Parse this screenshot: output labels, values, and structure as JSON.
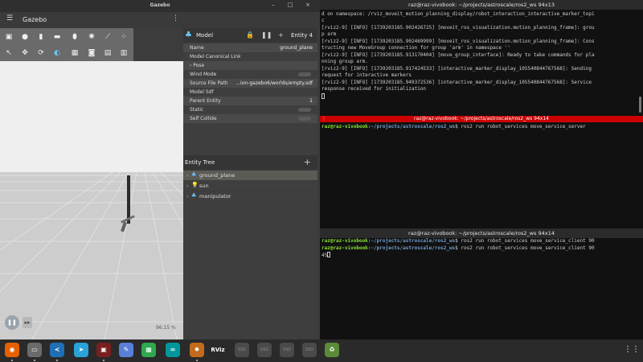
{
  "gazebo": {
    "window_title": "Gazebo",
    "app_name": "Gazebo",
    "window_controls": [
      "–",
      "□",
      "×"
    ],
    "menu_glyph": "☰",
    "more_glyph": "⋮",
    "toolbar_top": [
      "▣",
      "●",
      "▮",
      "▬",
      "⬮",
      "✺",
      "⟋",
      "⁘"
    ],
    "toolbar_bottom": [
      "↖",
      "✥",
      "⟳",
      "◐",
      "▦",
      "◙",
      "▤",
      "▥"
    ],
    "viewport": {
      "play_glyph": "❚❚",
      "step_glyph": "▸▸",
      "rtf": "96.15 %"
    },
    "inspector": {
      "icon": "♣",
      "title": "Model",
      "lock_glyph": "🔒",
      "pause_glyph": "❚❚",
      "plus_glyph": "+",
      "entity": "Entity 4",
      "rows": [
        {
          "key": "Name",
          "value": "ground_plane"
        },
        {
          "key": "Model Canonical Link",
          "value": ""
        },
        {
          "key": "› Pose",
          "value": ""
        },
        {
          "key": "Wind Mode",
          "value": ""
        },
        {
          "key": "Source File Path",
          "value": "...ion-gazebo6/worlds/empty.sdf"
        },
        {
          "key": "Model Sdf",
          "value": ""
        },
        {
          "key": "Parent Entity",
          "value": "1"
        },
        {
          "key": "Static",
          "value": ""
        },
        {
          "key": "Self Collide",
          "value": ""
        }
      ]
    },
    "entity_tree": {
      "title": "Entity Tree",
      "plus_glyph": "+",
      "items": [
        {
          "arrow": "›",
          "icon": "♣",
          "name": "ground_plane"
        },
        {
          "arrow": "›",
          "icon": "💡",
          "name": "sun"
        },
        {
          "arrow": "›",
          "icon": "♣",
          "name": "manipulator"
        }
      ]
    }
  },
  "terminal1": {
    "title": "raz@raz-vivobook: ~/projects/astroscale/ros2_ws 94x13",
    "lines": [
      "d on namespace: /rviz_moveit_motion_planning_display/robot_interaction_interactive_marker_topi",
      "c",
      "[rviz2-9] [INFO] [1739203185.902426725] [moveit_ros_visualization.motion_planning_frame]: grou",
      "p arm",
      "[rviz2-9] [INFO] [1739203185.902469999] [moveit_ros_visualization.motion_planning_frame]: Cons",
      "tructing new MoveGroup connection for group 'arm' in namespace ''",
      "[rviz2-9] [INFO] [1739203185.913170404] [move_group_interface]: Ready to take commands for pla",
      "nning group arm.",
      "[rviz2-9] [INFO] [1739203185.917424533] [interactive_marker_display_105540844767568]: Sending",
      " request for interactive markers",
      "[rviz2-9] [INFO] [1739203185.949372536] [interactive_marker_display_105540844767568]: Service",
      " response received for initialization"
    ]
  },
  "terminal2": {
    "title": "raz@raz-vivobook: ~/projects/astroscale/ros2_ws 94x14",
    "dots": "⋮",
    "prompt_user": "raz@raz-vivobook",
    "prompt_path": ":~/projects/astroscale/ros2_ws",
    "command": "$ ros2 run robot_services move_service_server"
  },
  "terminal3": {
    "title": "raz@raz-vivobook: ~/projects/astroscale/ros2_ws 94x14",
    "prompt_user": "raz@raz-vivobook",
    "prompt_path": ":~/projects/astroscale/ros2_ws",
    "command1": "$ ros2 run robot_services move_service_client 90",
    "command2": "$ ros2 run robot_services move_service_client 90",
    "cont": " 45"
  },
  "taskbar": {
    "items": [
      {
        "name": "firefox",
        "label": "◉",
        "color": "#e66000"
      },
      {
        "name": "files",
        "label": "▭",
        "color": "#6b6b6b"
      },
      {
        "name": "vscode",
        "label": "≺",
        "color": "#1f6fb5"
      },
      {
        "name": "telegram",
        "label": "➤",
        "color": "#2aa3d9"
      },
      {
        "name": "terminal",
        "label": "▣",
        "color": "#7a1f1f"
      },
      {
        "name": "text-editor",
        "label": "✎",
        "color": "#5a7fd8"
      },
      {
        "name": "calculator",
        "label": "▦",
        "color": "#2fa84f"
      },
      {
        "name": "arduino",
        "label": "∞",
        "color": "#00979c"
      },
      {
        "name": "gazebo",
        "label": "✸",
        "color": "#c46a1c"
      },
      {
        "name": "rviz",
        "label": "RViz",
        "color": "#2a2a2a"
      },
      {
        "name": "drive1",
        "label": "SSD",
        "color": "#4a4a4a"
      },
      {
        "name": "drive2",
        "label": "SSD",
        "color": "#4a4a4a"
      },
      {
        "name": "drive3",
        "label": "SSD",
        "color": "#4a4a4a"
      },
      {
        "name": "drive4",
        "label": "SSD",
        "color": "#4a4a4a"
      },
      {
        "name": "trash",
        "label": "♻",
        "color": "#5a8a3a"
      }
    ],
    "apps_grid": "⋮⋮⋮"
  }
}
